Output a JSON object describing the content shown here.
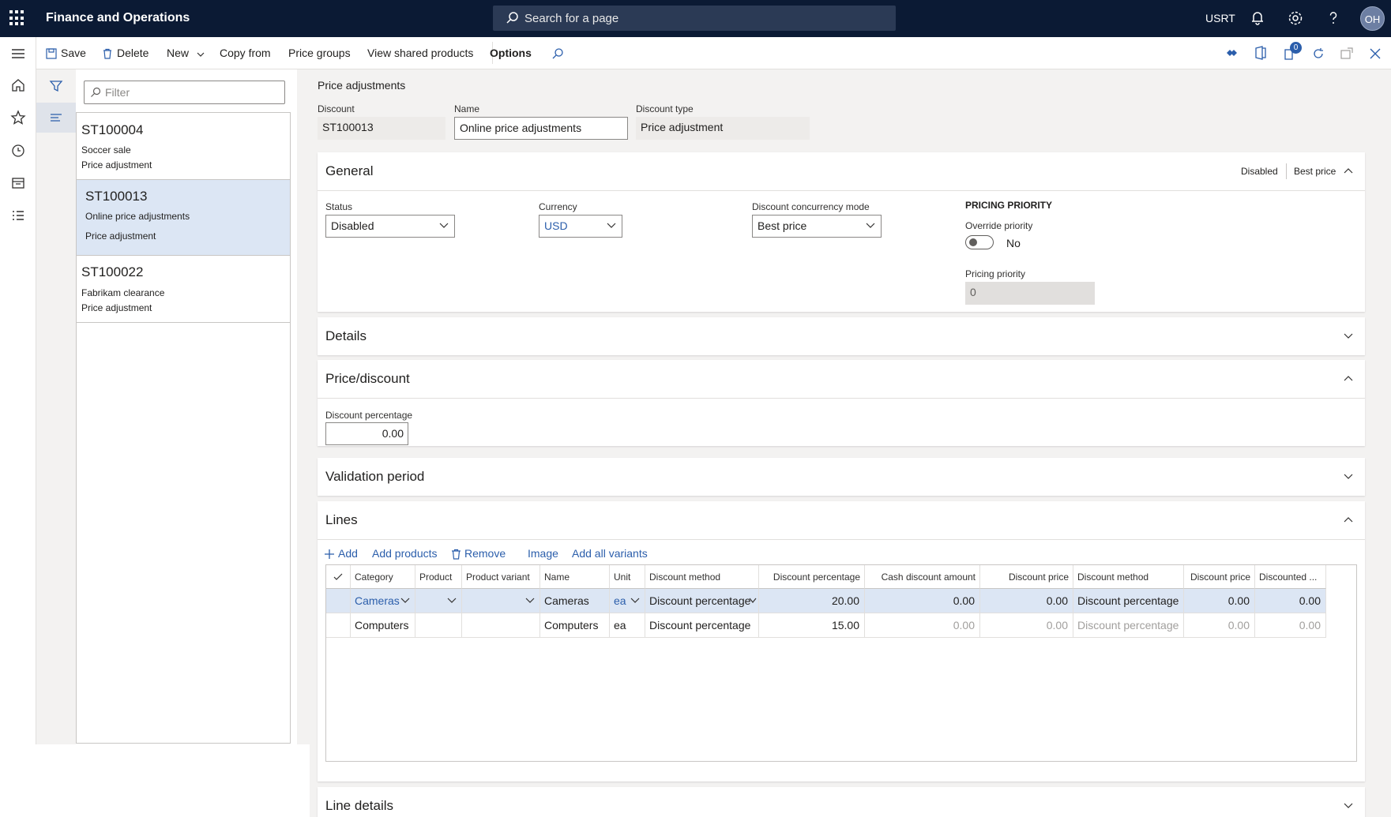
{
  "app": {
    "title": "Finance and Operations",
    "search_placeholder": "Search for a page",
    "company": "USRT",
    "avatar_initials": "OH",
    "notification_count": "0"
  },
  "actions": {
    "save": "Save",
    "delete": "Delete",
    "new": "New",
    "copy_from": "Copy from",
    "price_groups": "Price groups",
    "view_shared_products": "View shared products",
    "options": "Options"
  },
  "list": {
    "filter_placeholder": "Filter",
    "items": [
      {
        "id": "ST100004",
        "name": "Soccer sale",
        "type": "Price adjustment"
      },
      {
        "id": "ST100013",
        "name": "Online price adjustments",
        "type": "Price adjustment"
      },
      {
        "id": "ST100022",
        "name": "Fabrikam clearance",
        "type": "Price adjustment"
      }
    ]
  },
  "header": {
    "page_title": "Price adjustments",
    "discount_label": "Discount",
    "discount_value": "ST100013",
    "name_label": "Name",
    "name_value": "Online price adjustments",
    "discount_type_label": "Discount type",
    "discount_type_value": "Price adjustment"
  },
  "general": {
    "title": "General",
    "summary_status": "Disabled",
    "summary_mode": "Best price",
    "status_label": "Status",
    "status_value": "Disabled",
    "currency_label": "Currency",
    "currency_value": "USD",
    "concurrency_label": "Discount concurrency mode",
    "concurrency_value": "Best price",
    "pricing_priority_heading": "PRICING PRIORITY",
    "override_label": "Override priority",
    "override_value": "No",
    "pricing_priority_label": "Pricing priority",
    "pricing_priority_value": "0"
  },
  "details": {
    "title": "Details"
  },
  "price_discount": {
    "title": "Price/discount",
    "discount_percentage_label": "Discount percentage",
    "discount_percentage_value": "0.00"
  },
  "validation": {
    "title": "Validation period"
  },
  "lines": {
    "title": "Lines",
    "actions": {
      "add": "Add",
      "add_products": "Add products",
      "remove": "Remove",
      "image": "Image",
      "add_all_variants": "Add all variants"
    },
    "columns": [
      "Category",
      "Product",
      "Product variant",
      "Name",
      "Unit",
      "Discount method",
      "Discount percentage",
      "Cash discount amount",
      "Discount price",
      "Discount method",
      "Discount price",
      "Discounted ..."
    ],
    "rows": [
      [
        "Cameras",
        "",
        "",
        "Cameras",
        "ea",
        "Discount percentage",
        "20.00",
        "0.00",
        "0.00",
        "Discount percentage",
        "0.00",
        "0.00"
      ],
      [
        "Computers",
        "",
        "",
        "Computers",
        "ea",
        "Discount percentage",
        "15.00",
        "0.00",
        "0.00",
        "Discount percentage",
        "0.00",
        "0.00"
      ]
    ]
  },
  "line_details": {
    "title": "Line details"
  },
  "colors": {
    "topbar": "#0b1a34",
    "accent": "#2b5eab",
    "selected_row": "#dce6f4"
  },
  "icons": [
    "waffle-icon",
    "search-icon",
    "bell-icon",
    "gear-icon",
    "help-icon",
    "save-icon",
    "delete-icon",
    "filter-icon",
    "list-icon",
    "home-icon",
    "star-icon",
    "clock-icon",
    "workspace-icon",
    "modules-icon",
    "chevron-down-icon",
    "chevron-up-icon"
  ]
}
